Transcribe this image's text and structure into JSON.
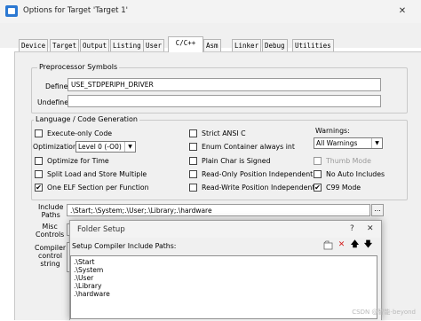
{
  "window": {
    "title": "Options for Target 'Target 1'",
    "close_glyph": "✕"
  },
  "tabs": [
    {
      "label": "Device",
      "active": false
    },
    {
      "label": "Target",
      "active": false
    },
    {
      "label": "Output",
      "active": false
    },
    {
      "label": "Listing",
      "active": false
    },
    {
      "label": "User",
      "active": false
    },
    {
      "label": "C/C++",
      "active": true
    },
    {
      "label": "Asm",
      "active": false
    },
    {
      "label": "Linker",
      "active": false
    },
    {
      "label": "Debug",
      "active": false
    },
    {
      "label": "Utilities",
      "active": false
    }
  ],
  "preprocessor": {
    "group_label": "Preprocessor Symbols",
    "define_label": "Define:",
    "define_value": "USE_STDPERIPH_DRIVER",
    "undefine_label": "Undefine:",
    "undefine_value": ""
  },
  "codegen": {
    "group_label": "Language / Code Generation",
    "execute_only": {
      "label": "Execute-only Code",
      "checked": false
    },
    "optimization_label": "Optimization:",
    "optimization_value": "Level 0 (-O0)",
    "optimize_time": {
      "label": "Optimize for Time",
      "checked": false
    },
    "split_load": {
      "label": "Split Load and Store Multiple",
      "checked": false
    },
    "one_elf": {
      "label": "One ELF Section per Function",
      "checked": true
    },
    "strict_ansi": {
      "label": "Strict ANSI C",
      "checked": false
    },
    "enum_int": {
      "label": "Enum Container always int",
      "checked": false
    },
    "plain_char": {
      "label": "Plain Char is Signed",
      "checked": false
    },
    "ro_pos": {
      "label": "Read-Only Position Independent",
      "checked": false
    },
    "rw_pos": {
      "label": "Read-Write Position Independent",
      "checked": false
    },
    "warnings_label": "Warnings:",
    "warnings_value": "All Warnings",
    "thumb_mode": {
      "label": "Thumb Mode",
      "checked": false
    },
    "no_auto_includes": {
      "label": "No Auto Includes",
      "checked": false
    },
    "c99_mode": {
      "label": "C99 Mode",
      "checked": true
    },
    "check_glyph": "✔"
  },
  "include": {
    "label_line1": "Include",
    "label_line2": "Paths",
    "value": ".\\Start;.\\System;.\\User;.\\Library;.\\hardware",
    "browse_label": "..."
  },
  "misc": {
    "label_line1": "Misc",
    "label_line2": "Controls"
  },
  "compiler": {
    "label_line1": "Compiler",
    "label_line2": "control",
    "label_line3": "string"
  },
  "folder_dialog": {
    "title": "Folder Setup",
    "help_glyph": "?",
    "close_glyph": "✕",
    "header": "Setup Compiler Include Paths:",
    "paths": [
      ".\\Start",
      ".\\System",
      ".\\User",
      ".\\Library",
      ".\\hardware"
    ],
    "tool_new": "new-folder-icon",
    "tool_delete": "delete-x-icon",
    "tool_up": "arrow-up-icon",
    "tool_down": "arrow-down-icon",
    "delete_color": "#d42020"
  },
  "watermark": "CSDN @智能-beyond"
}
